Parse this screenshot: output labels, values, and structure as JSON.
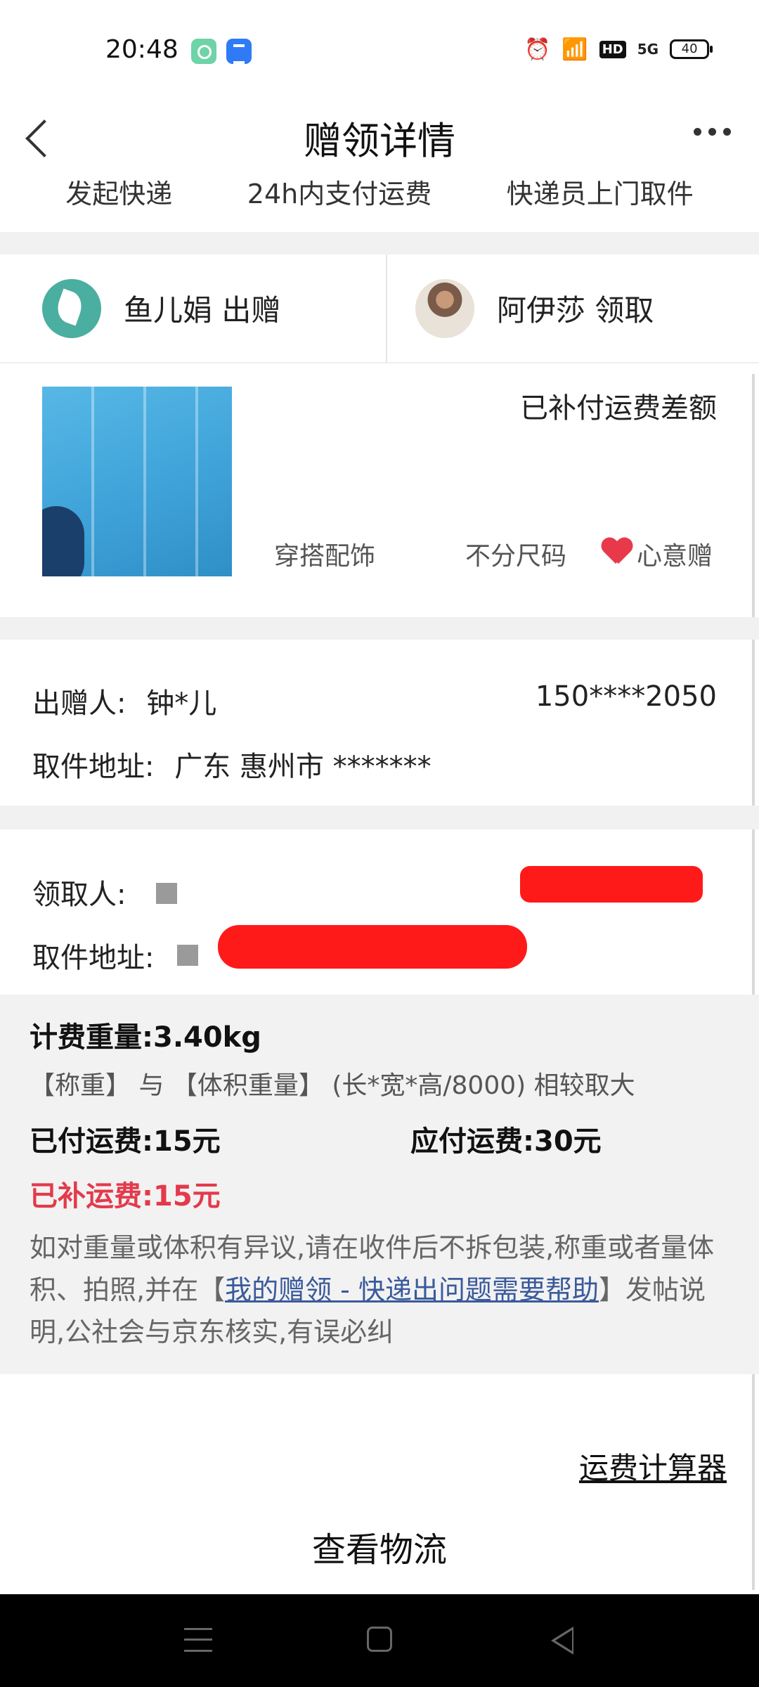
{
  "status_bar": {
    "time": "20:48",
    "network": "5G",
    "hd": "HD",
    "battery": "40",
    "icons": [
      "gallery-app-icon",
      "files-app-icon",
      "alarm-icon",
      "wifi-icon",
      "hd-icon",
      "signal-icon",
      "battery-icon"
    ]
  },
  "nav": {
    "title": "赠领详情",
    "icons": [
      "back-icon",
      "more-icon"
    ]
  },
  "steps": [
    "发起快递",
    "24h内支付运费",
    "快递员上门取件"
  ],
  "parties": {
    "giver": {
      "label": "鱼儿娟 出赠",
      "avatar": "leaf-avatar"
    },
    "receiver": {
      "label": "阿伊莎 领取",
      "avatar": "photo-avatar"
    }
  },
  "item": {
    "status": "已补付运费差额",
    "category": "穿搭配饰",
    "size": "不分尺码",
    "tag": "心意赠",
    "tag_icon": "heart-icon",
    "tag_color": "#e8394b"
  },
  "sender": {
    "name_label": "出赠人:",
    "name": "钟*儿",
    "phone": "150****2050",
    "address_label": "取件地址:",
    "address": "广东 惠州市 *******"
  },
  "receiver": {
    "name_label": "领取人:",
    "address_label": "取件地址:",
    "redaction_color": "#ff1a1a"
  },
  "fee": {
    "weight": "计费重量:3.40kg",
    "note": "【称重】 与 【体积重量】 (长*宽*高/8000) 相较取大",
    "paid": "已付运费:15元",
    "due": "应付运费:30元",
    "extra": "已补运费:15元",
    "extra_color": "#e33a4b",
    "desc_before": "如对重量或体积有异议,请在收件后不拆包装,称重或者量体积、拍照,并在【",
    "desc_link": "我的赠领 - 快递出问题需要帮助",
    "desc_after": "】发帖说明,公社会与京东核实,有误必纠"
  },
  "actions": {
    "calculator": "运费计算器",
    "logistics": "查看物流"
  },
  "system_nav": [
    "menu-icon",
    "home-icon",
    "back-triangle-icon"
  ]
}
